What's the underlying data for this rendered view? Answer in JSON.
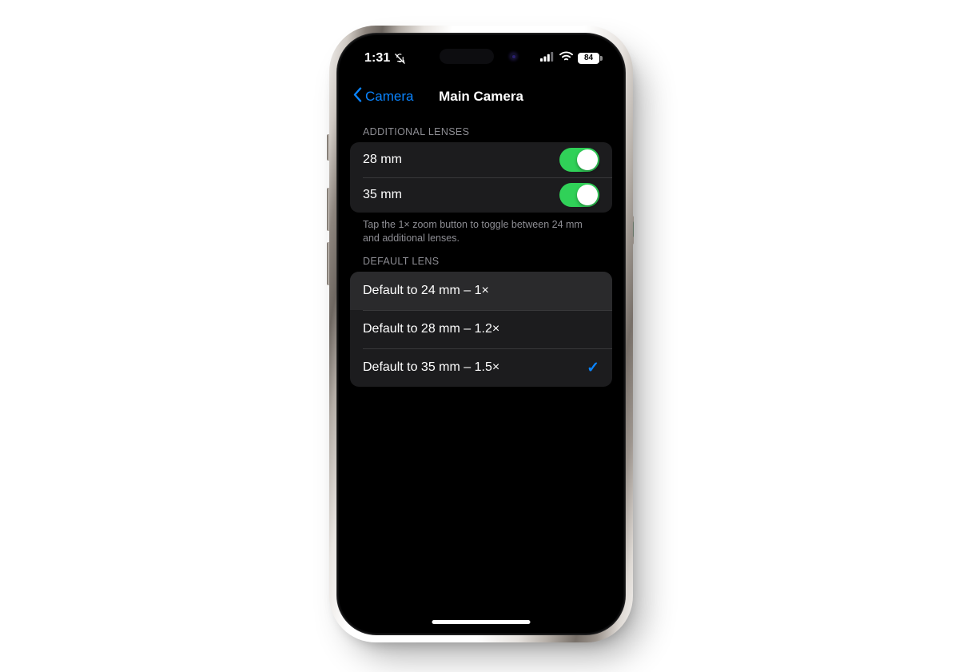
{
  "status_bar": {
    "time": "1:31",
    "mute_icon": "bell-slash-icon",
    "signal_icon": "cellular-signal-icon",
    "wifi_icon": "wifi-icon",
    "battery_level": "84"
  },
  "nav": {
    "back_label": "Camera",
    "back_icon": "chevron-left-icon",
    "title": "Main Camera"
  },
  "sections": {
    "additional_lenses": {
      "header": "ADDITIONAL LENSES",
      "rows": [
        {
          "label": "28 mm",
          "toggle": "on"
        },
        {
          "label": "35 mm",
          "toggle": "on"
        }
      ],
      "footer": "Tap the 1× zoom button to toggle between 24 mm and additional lenses."
    },
    "default_lens": {
      "header": "DEFAULT LENS",
      "rows": [
        {
          "label": "Default to 24 mm – 1×",
          "selected": false,
          "highlighted": true
        },
        {
          "label": "Default to 28 mm – 1.2×",
          "selected": false,
          "highlighted": false
        },
        {
          "label": "Default to 35 mm – 1.5×",
          "selected": true,
          "highlighted": false
        }
      ],
      "check_glyph": "✓"
    }
  },
  "colors": {
    "accent_blue": "#0A84FF",
    "toggle_green": "#30D158",
    "card_bg": "#1C1C1E",
    "screen_bg": "#000000",
    "secondary_text": "#8D8D93"
  }
}
